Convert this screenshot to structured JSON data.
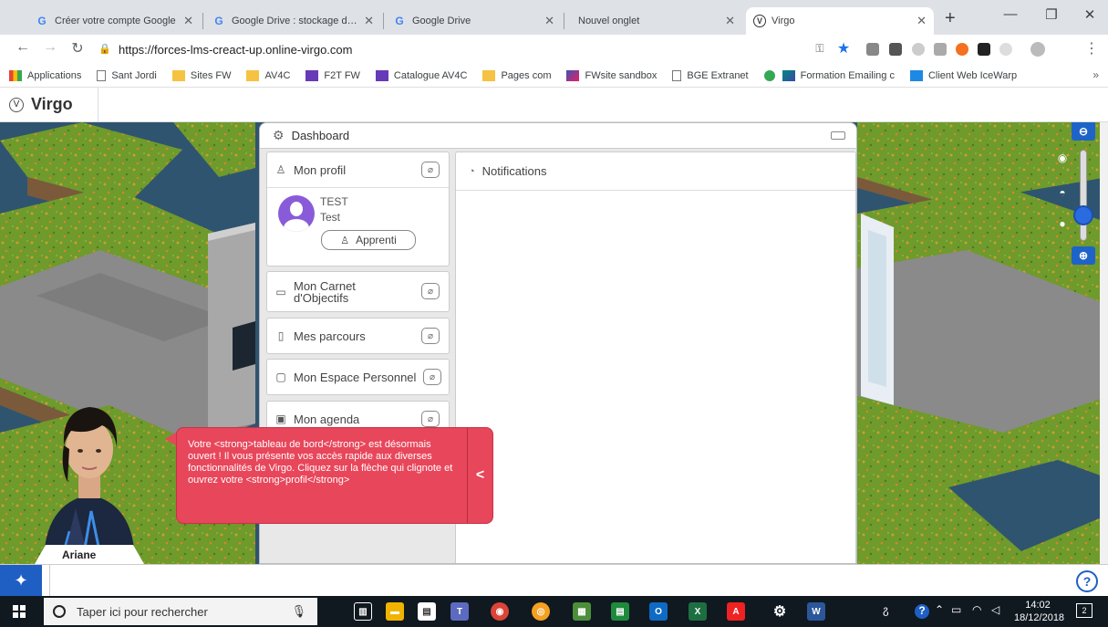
{
  "browser": {
    "tabs": [
      {
        "title": "Créer votre compte Google",
        "favicon": "google-icon",
        "active": false
      },
      {
        "title": "Google Drive : stockage de fichiers",
        "favicon": "google-icon",
        "active": false
      },
      {
        "title": "Google Drive",
        "favicon": "google-icon",
        "active": false
      },
      {
        "title": "Nouvel onglet",
        "favicon": "none",
        "active": false
      },
      {
        "title": "Virgo",
        "favicon": "virgo-icon",
        "active": true
      }
    ],
    "url": "https://forces-lms-creact-up.online-virgo.com",
    "bookmarks": [
      {
        "label": "Applications",
        "icon": "apps-icon"
      },
      {
        "label": "Sant Jordi",
        "icon": "page-icon"
      },
      {
        "label": "Sites FW",
        "icon": "folder-icon"
      },
      {
        "label": "AV4C",
        "icon": "folder-icon"
      },
      {
        "label": "F2T FW",
        "icon": "sheet-icon"
      },
      {
        "label": "Catalogue AV4C",
        "icon": "sheet-icon"
      },
      {
        "label": "Pages com",
        "icon": "folder-icon"
      },
      {
        "label": "FWsite sandbox",
        "icon": "app-icon"
      },
      {
        "label": "BGE Extranet",
        "icon": "page-icon"
      },
      {
        "label": "",
        "icon": "circle-icon"
      },
      {
        "label": "Formation Emailing c",
        "icon": "mail-icon"
      },
      {
        "label": "Client Web IceWarp",
        "icon": "x-icon"
      }
    ],
    "more": "»"
  },
  "virgo": {
    "logo": "Virgo"
  },
  "dashboard": {
    "title": "Dashboard",
    "profile": {
      "title": "Mon profil",
      "name": "TEST",
      "firstname": "Test",
      "role": "Apprenti"
    },
    "cards": [
      {
        "title_line1": "Mon Carnet",
        "title_line2": "d'Objectifs",
        "icon": "book-icon"
      },
      {
        "title": "Mes parcours",
        "icon": "bookmark-icon"
      },
      {
        "title": "Mon Espace Personnel",
        "icon": "briefcase-icon"
      },
      {
        "title": "Mon agenda",
        "icon": "calendar-icon"
      }
    ],
    "notifications": {
      "title": "Notifications"
    }
  },
  "guide": {
    "name": "Ariane",
    "message": "Votre <strong>tableau de bord</strong> est désormais ouvert ! Il vous présente vos accès rapide aux diverses fonctionnalités de Virgo. Cliquez sur la flèche qui clignote et ouvrez votre <strong>profil</strong>",
    "arrow": "<"
  },
  "taskbar": {
    "search_placeholder": "Taper ici pour rechercher",
    "time": "14:02",
    "date": "18/12/2018",
    "notifications_count": "2"
  },
  "colors": {
    "accent": "#1f5fc4",
    "guide_bubble": "#e8465a",
    "grass": "#6b8f2a",
    "path": "#8a8a8a"
  }
}
